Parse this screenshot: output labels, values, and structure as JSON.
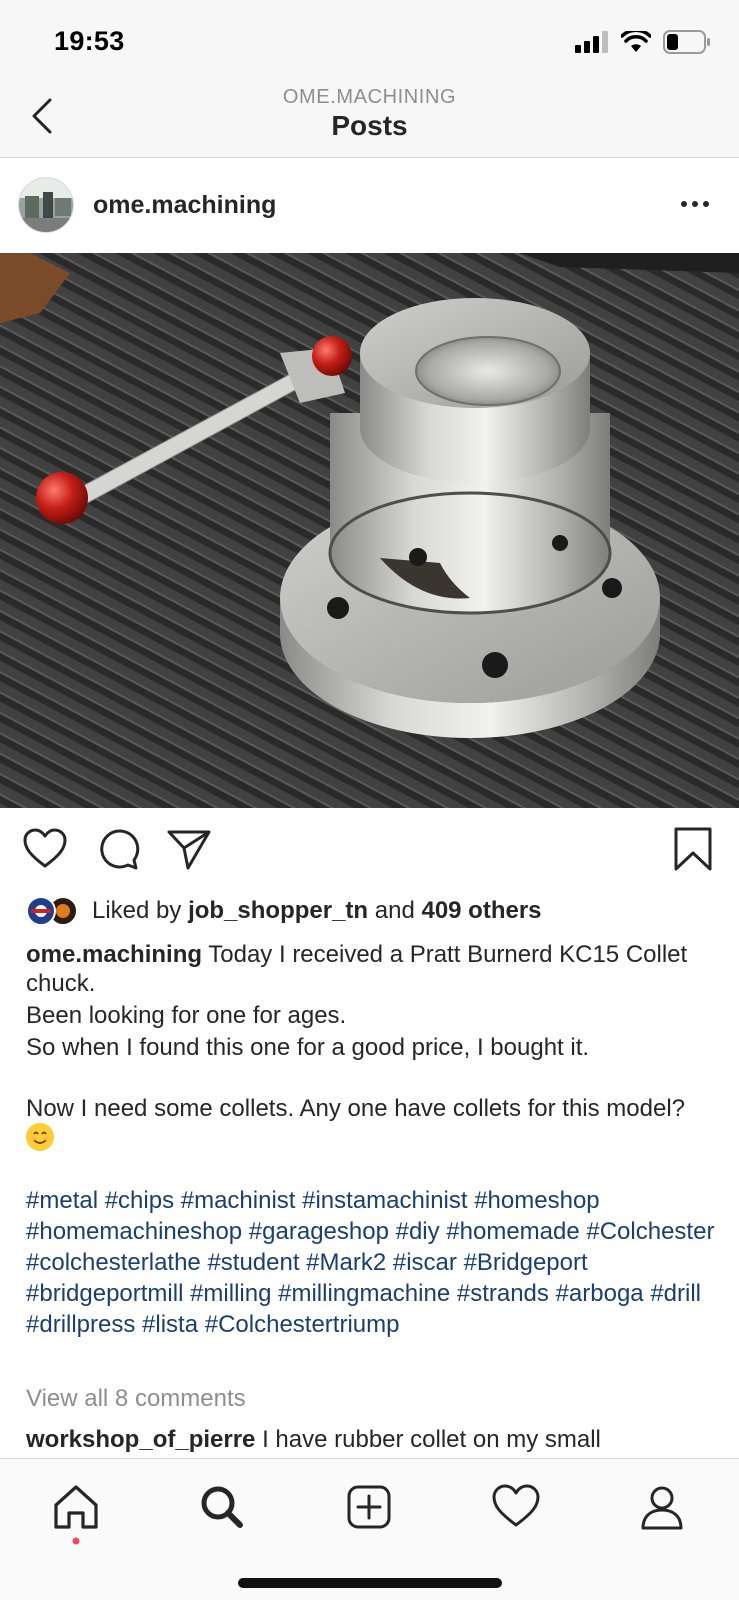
{
  "status": {
    "time": "19:53",
    "icons": [
      "cellular-signal-icon",
      "wifi-icon",
      "battery-icon"
    ]
  },
  "header": {
    "account": "OME.MACHINING",
    "title": "Posts"
  },
  "post": {
    "username": "ome.machining",
    "likes": {
      "prefix": "Liked by",
      "user": "job_shopper_tn",
      "connector": "and",
      "others": "409 others"
    },
    "caption": {
      "author": "ome.machining",
      "lines": [
        "Today I received a Pratt Burnerd KC15 Collet chuck.",
        "Been looking for one for ages.",
        "So when I found this one for a good price, I bought it.",
        "Now I need some collets.  Any one have collets for this model?"
      ],
      "hashtags": "#metal #chips #machinist #instamachinist #homeshop #homemachineshop #garageshop #diy #homemade #Colchester #colchesterlathe #student #Mark2 #iscar #Bridgeport #bridgeportmill #milling #millingmachine #strands #arboga #drill #drillpress #lista #Colchestertriump"
    },
    "view_all_comments": "View all 8 comments",
    "comment": {
      "author": "workshop_of_pierre",
      "text": "I have rubber collet on my small"
    }
  },
  "tabs": [
    "home-icon",
    "search-icon",
    "new-post-icon",
    "activity-heart-icon",
    "profile-icon"
  ],
  "colors": {
    "hashtag": "#1b3e72",
    "notification_dot": "#ed4956",
    "muted": "#8e8e8e"
  }
}
